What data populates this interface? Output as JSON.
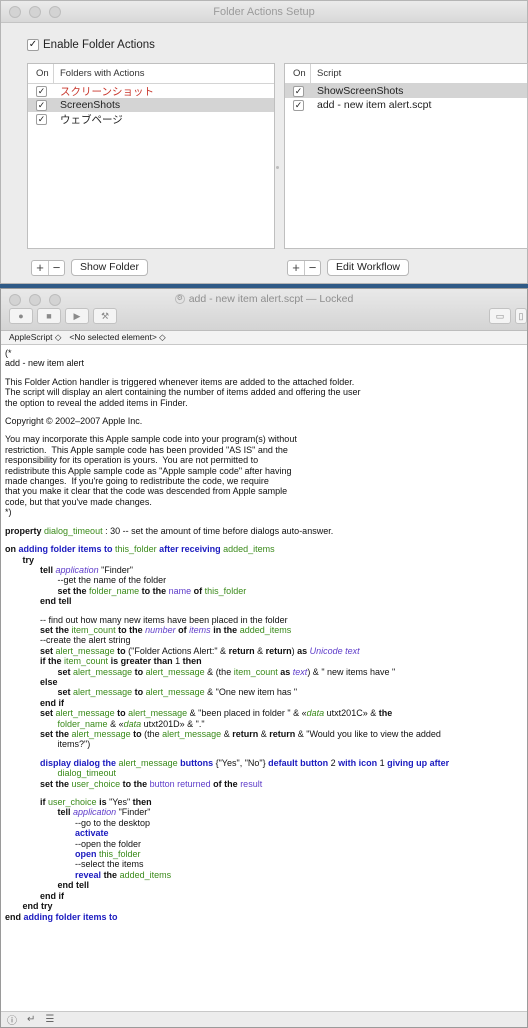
{
  "fa_window": {
    "title": "Folder Actions Setup",
    "enable_label": "Enable Folder Actions",
    "enable_checked": true,
    "folders_header_on": "On",
    "folders_header_name": "Folders with Actions",
    "folders": [
      {
        "checked": "✓",
        "name": "スクリーンショット",
        "missing": true,
        "selected": false
      },
      {
        "checked": "✓",
        "name": "ScreenShots",
        "missing": false,
        "selected": true
      },
      {
        "checked": "✓",
        "name": "ウェブページ",
        "missing": false,
        "selected": false
      }
    ],
    "scripts_header_on": "On",
    "scripts_header_name": "Script",
    "scripts": [
      {
        "checked": "✓",
        "name": "ShowScreenShots",
        "selected": true
      },
      {
        "checked": "✓",
        "name": "add - new item alert.scpt",
        "selected": false
      }
    ],
    "plus": "+",
    "minus": "−",
    "show_folder": "Show Folder",
    "edit_workflow": "Edit Workflow"
  },
  "se_window": {
    "title": "add - new item alert.scpt",
    "title_suffix": "— Locked",
    "language": "AppleScript ◇",
    "element": "<No selected element> ◇",
    "status_icons": [
      "ⓘ",
      "↵",
      "☰"
    ]
  },
  "code": {
    "c1": "(*",
    "c2": "add - new item alert",
    "c3": "This Folder Action handler is triggered whenever items are added to the attached folder.",
    "c4": "The script will display an alert containing the number of items added and offering the user",
    "c5": "the option to reveal the added items in Finder.",
    "c6": "Copyright © 2002–2007 Apple Inc.",
    "c7": "You may incorporate this Apple sample code into your program(s) without",
    "c8": "restriction.  This Apple sample code has been provided \"AS IS\" and the",
    "c9": "responsibility for its operation is yours.  You are not permitted to",
    "c10": "redistribute this Apple sample code as \"Apple sample code\" after having",
    "c11": "made changes.  If you're going to redistribute the code, we require",
    "c12": "that you make it clear that the code was descended from Apple sample",
    "c13": "code, but that you've made changes.",
    "c14": "*)",
    "prop_kw": "property",
    "prop_var": "dialog_timeout",
    "prop_rest": " : 30 -- set the amount of time before dialogs auto-answer.",
    "on_kw": "on",
    "on_handler": "adding folder items to",
    "on_param1": "this_folder",
    "on_after": "after receiving",
    "on_param2": "added_items",
    "try_kw": "try",
    "tell_kw": "tell",
    "application_kw": "application",
    "finder_str": "\"Finder\"",
    "cmt_get_name": "--get the name of the folder",
    "set_kw": "set the",
    "folder_name_var": "folder_name",
    "to_the_kw": "to the",
    "name_prop": "name",
    "of_kw": "of",
    "this_folder_var": "this_folder",
    "end_tell": "end tell",
    "cmt_find": "-- find out how many new items have been placed in the folder",
    "item_count_var": "item_count",
    "number_kw": "number",
    "of_kw2": "of",
    "items_kw": "items",
    "in_the_kw": "in the",
    "added_items_var": "added_items",
    "cmt_create": "--create the alert string",
    "set_kw2": "set",
    "alert_message_var": "alert_message",
    "to_kw": "to",
    "fa_alert_str": "(\"Folder Actions Alert:\" & ",
    "return_kw": "return",
    "amp": " & ",
    "close_paren": ")",
    "as_kw": "as",
    "unicode_text": "Unicode text",
    "if_the": "if the",
    "is_greater": "is greater than",
    "one": "1",
    "then_kw": "then",
    "open_paren_the": "(the",
    "text_kw": "text",
    "new_items_have": ") & \" new items have \"",
    "else_kw": "else",
    "one_new_item": " & \"One new item has \"",
    "end_if": "end if",
    "been_placed": " & \"been placed in folder \" & «",
    "data_kw": "data",
    "utxt1": " utxt201C» & ",
    "the_kw": "the",
    "utxt2_a": " & «",
    "utxt2_b": " utxt201D» & \".\"",
    "would_you": " & \"Would you like to view the added",
    "items_q": "items?\")",
    "display_kw": "display dialog the",
    "buttons_kw": "buttons",
    "buttons_list": " {\"Yes\", \"No\"} ",
    "default_button": "default button",
    "two": " 2 ",
    "with_icon": "with icon",
    "one_sp": " 1 ",
    "giving_up": "giving up after",
    "user_choice_var": "user_choice",
    "button_returned": "button returned",
    "of_the_kw": "of the",
    "result_kw": "result",
    "if_kw": "if",
    "is_kw": "is",
    "yes_str": " \"Yes\" ",
    "cmt_desktop": "--go to the desktop",
    "activate_kw": "activate",
    "cmt_open": "--open the folder",
    "open_kw": "open",
    "cmt_select": "--select the items",
    "reveal_kw": "reveal",
    "end_try": "end try",
    "end_kw": "end",
    "end_handler": "adding folder items to"
  }
}
